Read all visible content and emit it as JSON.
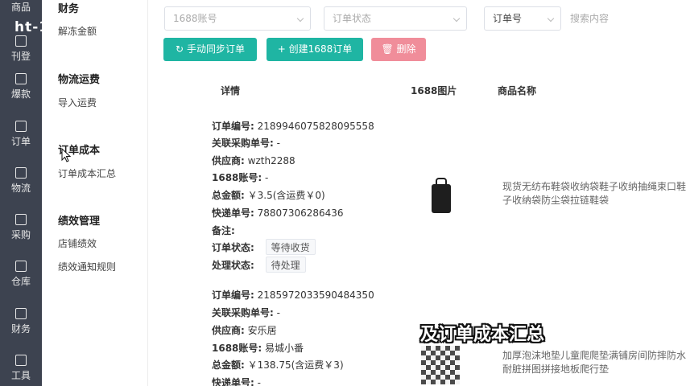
{
  "app": {
    "logo": "ht-1"
  },
  "leftnav": {
    "items": [
      {
        "label": "商品",
        "icon": "box-icon"
      },
      {
        "label": "刊登",
        "icon": "upload-icon"
      },
      {
        "label": "爆款",
        "icon": "fire-icon"
      },
      {
        "label": "订单",
        "icon": "order-icon"
      },
      {
        "label": "物流",
        "icon": "truck-icon"
      },
      {
        "label": "采购",
        "icon": "cart-icon"
      },
      {
        "label": "仓库",
        "icon": "warehouse-icon"
      },
      {
        "label": "财务",
        "icon": "finance-icon"
      },
      {
        "label": "工具",
        "icon": "tool-icon"
      }
    ]
  },
  "submenu": {
    "finance_title": "财务",
    "finance_item": "解冻金额",
    "logistics_title": "物流运费",
    "logistics_item": "导入运费",
    "cost_title": "订单成本",
    "cost_item": "订单成本汇总",
    "perf_title": "绩效管理",
    "perf_item1": "店铺绩效",
    "perf_item2": "绩效通知规则"
  },
  "filters": {
    "select1": "1688账号",
    "select2": "订单状态",
    "select3": "订单号",
    "search_placeholder": "搜索内容"
  },
  "toolbar": {
    "sync_label": "手动同步订单",
    "create_label": "创建1688订单",
    "delete_label": "删除"
  },
  "table": {
    "headers": {
      "detail": "详情",
      "image": "1688图片",
      "name": "商品名称"
    }
  },
  "orders": [
    {
      "order_no_label": "订单编号:",
      "order_no": "2189946075828095558",
      "related_label": "关联采购单号:",
      "related": "-",
      "supplier_label": "供应商:",
      "supplier": "wzth2288",
      "account_label": "1688账号:",
      "account": "-",
      "total_label": "总金额:",
      "total": "￥3.5(含运费￥0)",
      "express_label": "快递单号:",
      "express": "78807306286436",
      "remark_label": "备注:",
      "status_label": "订单状态:",
      "status": "等待收货",
      "process_label": "处理状态:",
      "process": "待处理",
      "product_name": "现货无纺布鞋袋收纳袋鞋子收纳抽绳束口鞋子收纳袋防尘袋拉链鞋袋"
    },
    {
      "order_no_label": "订单编号:",
      "order_no": "2185972033590484350",
      "related_label": "关联采购单号:",
      "related": "-",
      "supplier_label": "供应商:",
      "supplier": "安乐居",
      "account_label": "1688账号:",
      "account": "易城小番",
      "total_label": "总金额:",
      "total": "￥138.75(含运费￥3)",
      "express_label": "快递单号:",
      "express": "-",
      "product_name": "加厚泡沫地垫儿童爬爬垫满铺房间防摔防水耐脏拼图拼接地板爬行垫"
    }
  ],
  "caption": "及订单成本汇总"
}
